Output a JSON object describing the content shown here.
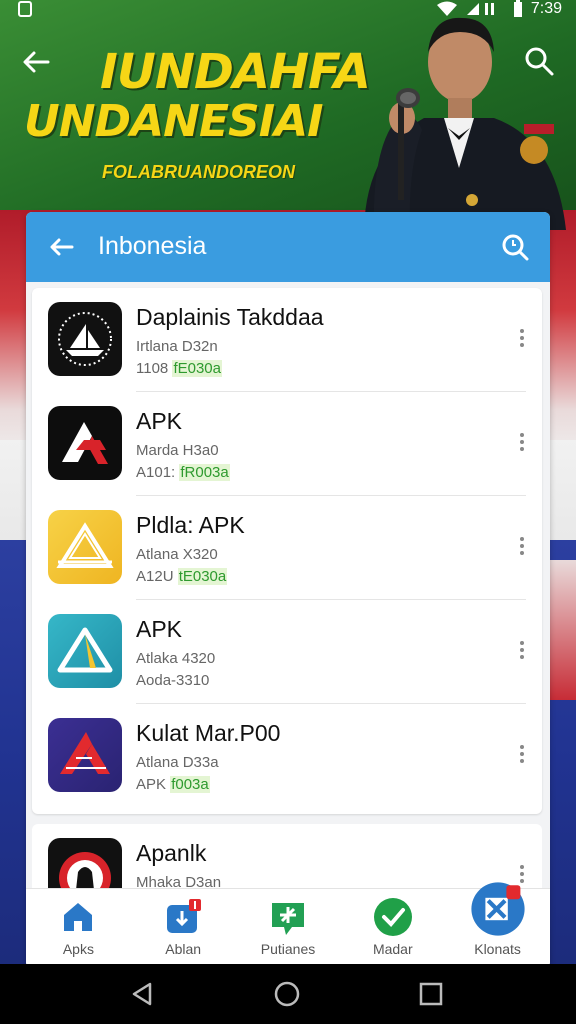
{
  "status": {
    "time": "7:39"
  },
  "hero": {
    "title_line1": "IUNDAHFA",
    "title_line2": "UNDANESIAI",
    "subtitle": "FOLABRUANDOREON"
  },
  "appbar": {
    "title": "Inbonesia"
  },
  "apps": [
    {
      "name": "Daplainis Takddaa",
      "meta1": "Irtlana D32n",
      "meta2_prefix": "1108 ",
      "meta2_highlight": "fE030a",
      "icon": "ship-logo-icon",
      "bg": "#111111"
    },
    {
      "name": "APK",
      "meta1": "Marda H3a0",
      "meta2_prefix": "A101: ",
      "meta2_highlight": "fR003a",
      "icon": "apk-a-logo-icon",
      "bg": "#0d0d0d"
    },
    {
      "name": "Pldla: APK",
      "meta1": "Atlana X320",
      "meta2_prefix": "A12U ",
      "meta2_highlight": "tE030a",
      "icon": "triangle-logo-icon",
      "bg": "#f3c531"
    },
    {
      "name": "APK",
      "meta1": "Atlaka 4320",
      "meta2_prefix": "Aoda-3310",
      "meta2_highlight": "",
      "icon": "teal-delta-logo-icon",
      "bg": "#27a2b8"
    },
    {
      "name": "Kulat Mar.P00",
      "meta1": "Atlana D33a",
      "meta2_prefix": "APK ",
      "meta2_highlight": "f003a",
      "icon": "red-a-logo-icon",
      "bg": "#3a2c8c"
    },
    {
      "name": "Apanlk",
      "meta1": "Mhaka D3an",
      "meta2_prefix": "",
      "meta2_highlight": "",
      "icon": "garuda-logo-icon",
      "bg": "#111111"
    }
  ],
  "tabs": [
    {
      "label": "Apks",
      "icon": "home-icon"
    },
    {
      "label": "Ablan",
      "icon": "download-icon"
    },
    {
      "label": "Putianes",
      "icon": "update-icon"
    },
    {
      "label": "Madar",
      "icon": "check-icon"
    },
    {
      "label": "Klonats",
      "icon": "profile-icon"
    }
  ],
  "colors": {
    "accent": "#3a9ce0",
    "flag_red": "#c72c36",
    "green": "#2e9a2e",
    "yellow": "#f6d616"
  }
}
